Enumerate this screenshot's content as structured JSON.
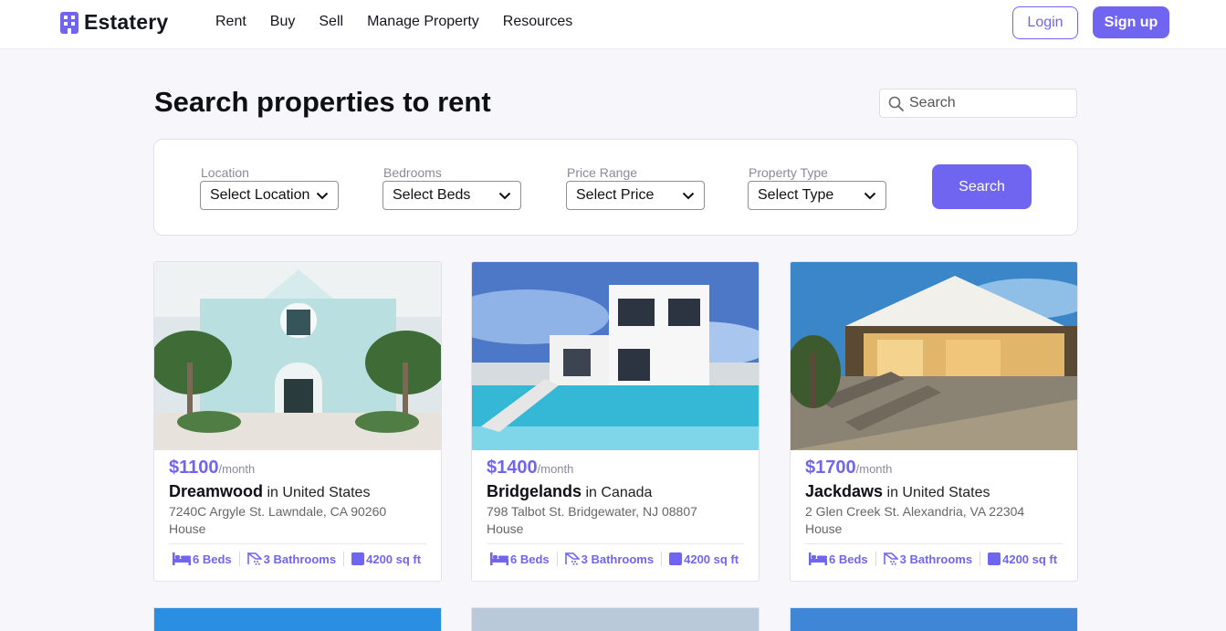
{
  "brand": {
    "name": "Estatery",
    "accent": "#7065f0"
  },
  "nav": {
    "items": [
      "Rent",
      "Buy",
      "Sell",
      "Manage Property",
      "Resources"
    ]
  },
  "auth": {
    "login_label": "Login",
    "signup_label": "Sign up"
  },
  "page": {
    "title": "Search properties to rent"
  },
  "search": {
    "placeholder": "Search"
  },
  "filters": [
    {
      "label": "Location",
      "value": "Select Location"
    },
    {
      "label": "Bedrooms",
      "value": "Select Beds"
    },
    {
      "label": "Price Range",
      "value": "Select Price"
    },
    {
      "label": "Property Type",
      "value": "Select Type"
    }
  ],
  "filter_button_label": "Search",
  "listings": [
    {
      "price": "$1100",
      "period": "/month",
      "name": "Dreamwood",
      "country_prefix": "in",
      "country": "United States",
      "address": "7240C Argyle St. Lawndale, CA 90260",
      "type": "House",
      "beds": "6 Beds",
      "baths": "3 Bathrooms",
      "area": "4200 sq ft"
    },
    {
      "price": "$1400",
      "period": "/month",
      "name": "Bridgelands",
      "country_prefix": "in",
      "country": "Canada",
      "address": "798 Talbot St. Bridgewater, NJ 08807",
      "type": "House",
      "beds": "6 Beds",
      "baths": "3 Bathrooms",
      "area": "4200 sq ft"
    },
    {
      "price": "$1700",
      "period": "/month",
      "name": "Jackdaws",
      "country_prefix": "in",
      "country": "United States",
      "address": "2 Glen Creek St. Alexandria, VA 22304",
      "type": "House",
      "beds": "6 Beds",
      "baths": "3 Bathrooms",
      "area": "4200 sq ft"
    }
  ]
}
